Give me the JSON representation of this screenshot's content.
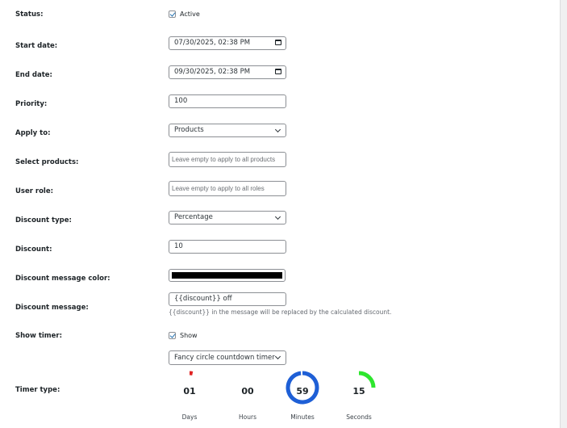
{
  "status": {
    "label": "Status:",
    "checkbox_label": "Active",
    "checked": true
  },
  "start_date": {
    "label": "Start date:",
    "value": "07/30/2025, 02:38 PM"
  },
  "end_date": {
    "label": "End date:",
    "value": "09/30/2025, 02:38 PM"
  },
  "priority": {
    "label": "Priority:",
    "value": "100"
  },
  "apply_to": {
    "label": "Apply to:",
    "value": "Products"
  },
  "select_products": {
    "label": "Select products:",
    "placeholder": "Leave empty to apply to all products"
  },
  "user_role": {
    "label": "User role:",
    "placeholder": "Leave empty to apply to all roles"
  },
  "discount_type": {
    "label": "Discount type:",
    "value": "Percentage"
  },
  "discount": {
    "label": "Discount:",
    "value": "10"
  },
  "discount_message_color": {
    "label": "Discount message color:",
    "color": "#000000"
  },
  "discount_message": {
    "label": "Discount message:",
    "value": "{{discount}} off",
    "description": "{{discount}} in the message will be replaced by the calculated discount."
  },
  "show_timer": {
    "label": "Show timer:",
    "checkbox_label": "Show",
    "checked": true
  },
  "timer_type": {
    "label": "Timer type:",
    "value": "Fancy circle countdown timer",
    "countdown": [
      {
        "value": "01",
        "unit": "Days",
        "fraction": 0.0333,
        "color": "#e02424"
      },
      {
        "value": "00",
        "unit": "Hours",
        "fraction": 0,
        "color": "#f0b400"
      },
      {
        "value": "59",
        "unit": "Minutes",
        "fraction": 0.983,
        "color": "#1e5fd6"
      },
      {
        "value": "15",
        "unit": "Seconds",
        "fraction": 0.25,
        "color": "#2ee62e"
      }
    ]
  },
  "colors": {
    "link_blue": "#2271b1",
    "border": "#8c8f94"
  }
}
